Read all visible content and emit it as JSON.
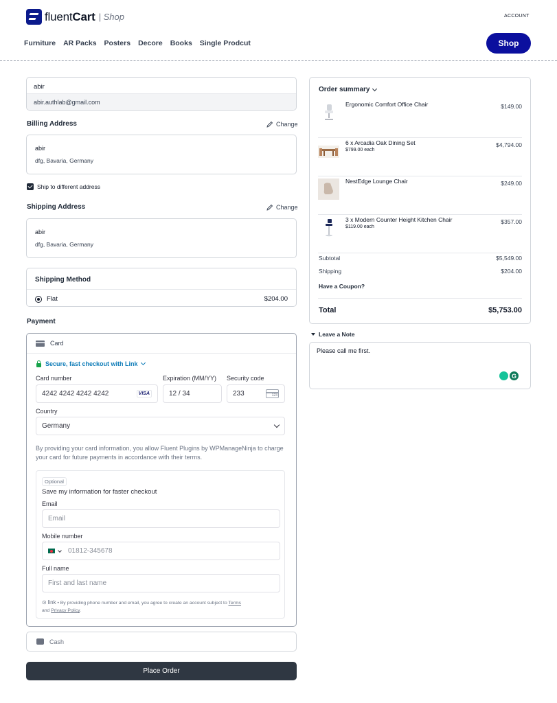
{
  "header": {
    "brand_bold": "fluent",
    "brand_rest": "Cart",
    "brand_suffix": "| Shop",
    "account_label": "ACCOUNT",
    "nav": [
      "Furniture",
      "AR Packs",
      "Posters",
      "Decore",
      "Books",
      "Single Prodcut"
    ],
    "shop_button": "Shop",
    "accent_color": "#0b0f9e"
  },
  "contact": {
    "name": "abir",
    "email": "abir.authlab@gmail.com"
  },
  "billing": {
    "title": "Billing Address",
    "change_label": "Change",
    "name": "abir",
    "address": "dfg, Bavaria, Germany"
  },
  "ship_different": {
    "label": "Ship to different address",
    "checked": true
  },
  "shipping": {
    "title": "Shipping Address",
    "change_label": "Change",
    "name": "abir",
    "address": "dfg, Bavaria, Germany"
  },
  "shipping_method": {
    "title": "Shipping Method",
    "option_label": "Flat",
    "option_price": "$204.00",
    "selected": true
  },
  "payment": {
    "title": "Payment",
    "card_tab": "Card",
    "link_text": "Secure, fast checkout with Link",
    "card_number_label": "Card number",
    "card_number_value": "4242 4242 4242 4242",
    "card_brand": "VISA",
    "expiration_label": "Expiration (MM/YY)",
    "expiration_value": "12 / 34",
    "security_label": "Security code",
    "security_value": "233",
    "country_label": "Country",
    "country_value": "Germany",
    "terms": "By providing your card information, you allow Fluent Plugins by WPManageNinja to charge your card for future payments in accordance with their terms.",
    "optional_tag": "Optional",
    "save_info": "Save my information for faster checkout",
    "email_label": "Email",
    "email_placeholder": "Email",
    "mobile_label": "Mobile number",
    "mobile_value": "01812-345678",
    "fullname_label": "Full name",
    "fullname_placeholder": "First and last name",
    "link_logo": "link",
    "link_footer_text": "• By providing phone number and email, you agree to create an account subject to",
    "terms_link": "Terms",
    "and_text": "and",
    "privacy_link": "Privacy Policy",
    "cash_tab": "Cash",
    "place_order": "Place Order"
  },
  "summary": {
    "title": "Order summary",
    "items": [
      {
        "name": "Ergonomic Comfort Office Chair",
        "sub": "",
        "price": "$149.00",
        "icon": "office-chair"
      },
      {
        "name": "6 x Arcadia Oak Dining Set",
        "sub": "$799.00 each",
        "price": "$4,794.00",
        "icon": "dining-set"
      },
      {
        "name": "NestEdge Lounge Chair",
        "sub": "",
        "price": "$249.00",
        "icon": "lounge-chair"
      },
      {
        "name": "3 x Modern Counter Height Kitchen Chair",
        "sub": "$119.00 each",
        "price": "$357.00",
        "icon": "bar-stool"
      }
    ],
    "subtotal_label": "Subtotal",
    "subtotal_value": "$5,549.00",
    "shipping_label": "Shipping",
    "shipping_value": "$204.00",
    "coupon_label": "Have a Coupon?",
    "total_label": "Total",
    "total_value": "$5,753.00"
  },
  "note": {
    "toggle_label": "Leave a Note",
    "value": "Please call me first.",
    "grammarly_letter": "G"
  }
}
